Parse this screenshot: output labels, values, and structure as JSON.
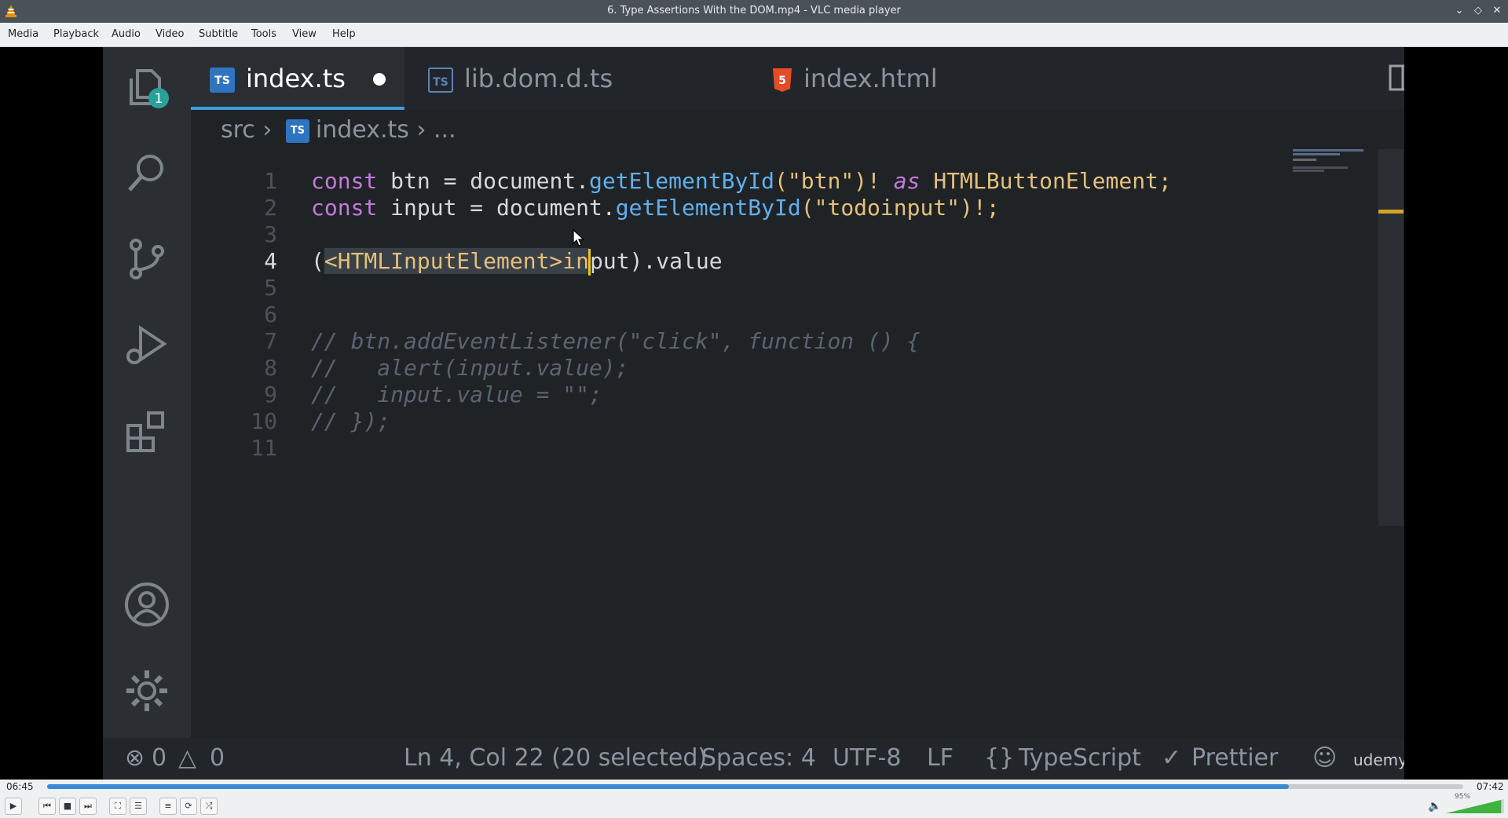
{
  "window": {
    "title": "6. Type Assertions With the DOM.mp4 - VLC media player"
  },
  "menu": [
    "Media",
    "Playback",
    "Audio",
    "Video",
    "Subtitle",
    "Tools",
    "View",
    "Help"
  ],
  "video_frame": {
    "activity_badge": "1",
    "tabs": [
      {
        "label": "index.ts",
        "badge": "TS",
        "active": true,
        "modified": true
      },
      {
        "label": "lib.dom.d.ts",
        "badge": "TS",
        "active": false
      },
      {
        "label": "index.html",
        "badge": "5",
        "active": false
      }
    ],
    "breadcrumb": {
      "folder": "src",
      "file": "index.ts",
      "ellipsis": "..."
    },
    "line_numbers": [
      "1",
      "2",
      "3",
      "4",
      "5",
      "6",
      "7",
      "8",
      "9",
      "10",
      "11"
    ],
    "code_text": {
      "l1_const": "const",
      "l1_mid": " btn = document.",
      "l1_fn": "getElementById",
      "l1_arg": "(\"btn\")! ",
      "l1_as": "as",
      "l1_type": " HTMLButtonElement;",
      "l2_const": "const",
      "l2_mid": " input = document.",
      "l2_fn": "getElementById",
      "l2_arg": "(\"todoinput\")!;",
      "l4_open": "(",
      "l4_sel_a": "<HTMLInputElement>in",
      "l4_sel_b": "put",
      "l4_rest": ").value",
      "l7": "// btn.addEventListener(\"click\", function () {",
      "l8": "//   alert(input.value);",
      "l9": "//   input.value = \"\";",
      "l10": "// });"
    },
    "status": {
      "errors": "0",
      "warnings": "0",
      "position": "Ln 4, Col 22 (20 selected)",
      "spaces": "Spaces: 4",
      "encoding": "UTF-8",
      "eol": "LF",
      "language": "TypeScript",
      "formatter": "Prettier",
      "watermark": "udemy"
    }
  },
  "player": {
    "elapsed": "06:45",
    "total": "07:42",
    "progress": 0.877,
    "volume_label": "95%",
    "volume": 0.95
  }
}
